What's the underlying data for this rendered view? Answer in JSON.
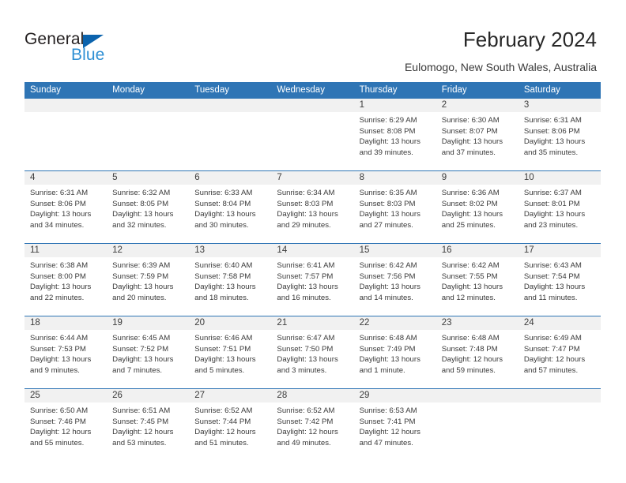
{
  "brand": {
    "name_dark": "General",
    "name_blue": "Blue",
    "colors": {
      "dark": "#231f20",
      "blue": "#2e8fd4",
      "triangle": "#0b63ad"
    }
  },
  "header": {
    "title": "February 2024",
    "subtitle": "Eulomogo, New South Wales, Australia"
  },
  "calendar": {
    "accent_color": "#2f75b5",
    "daynum_band_color": "#f1f1f1",
    "weekday_headers": [
      "Sunday",
      "Monday",
      "Tuesday",
      "Wednesday",
      "Thursday",
      "Friday",
      "Saturday"
    ],
    "labels": {
      "sunrise": "Sunrise:",
      "sunset": "Sunset:",
      "daylight": "Daylight:"
    },
    "weeks": [
      [
        {
          "day": ""
        },
        {
          "day": ""
        },
        {
          "day": ""
        },
        {
          "day": ""
        },
        {
          "day": "1",
          "sunrise": "Sunrise: 6:29 AM",
          "sunset": "Sunset: 8:08 PM",
          "daylight1": "Daylight: 13 hours",
          "daylight2": "and 39 minutes."
        },
        {
          "day": "2",
          "sunrise": "Sunrise: 6:30 AM",
          "sunset": "Sunset: 8:07 PM",
          "daylight1": "Daylight: 13 hours",
          "daylight2": "and 37 minutes."
        },
        {
          "day": "3",
          "sunrise": "Sunrise: 6:31 AM",
          "sunset": "Sunset: 8:06 PM",
          "daylight1": "Daylight: 13 hours",
          "daylight2": "and 35 minutes."
        }
      ],
      [
        {
          "day": "4",
          "sunrise": "Sunrise: 6:31 AM",
          "sunset": "Sunset: 8:06 PM",
          "daylight1": "Daylight: 13 hours",
          "daylight2": "and 34 minutes."
        },
        {
          "day": "5",
          "sunrise": "Sunrise: 6:32 AM",
          "sunset": "Sunset: 8:05 PM",
          "daylight1": "Daylight: 13 hours",
          "daylight2": "and 32 minutes."
        },
        {
          "day": "6",
          "sunrise": "Sunrise: 6:33 AM",
          "sunset": "Sunset: 8:04 PM",
          "daylight1": "Daylight: 13 hours",
          "daylight2": "and 30 minutes."
        },
        {
          "day": "7",
          "sunrise": "Sunrise: 6:34 AM",
          "sunset": "Sunset: 8:03 PM",
          "daylight1": "Daylight: 13 hours",
          "daylight2": "and 29 minutes."
        },
        {
          "day": "8",
          "sunrise": "Sunrise: 6:35 AM",
          "sunset": "Sunset: 8:03 PM",
          "daylight1": "Daylight: 13 hours",
          "daylight2": "and 27 minutes."
        },
        {
          "day": "9",
          "sunrise": "Sunrise: 6:36 AM",
          "sunset": "Sunset: 8:02 PM",
          "daylight1": "Daylight: 13 hours",
          "daylight2": "and 25 minutes."
        },
        {
          "day": "10",
          "sunrise": "Sunrise: 6:37 AM",
          "sunset": "Sunset: 8:01 PM",
          "daylight1": "Daylight: 13 hours",
          "daylight2": "and 23 minutes."
        }
      ],
      [
        {
          "day": "11",
          "sunrise": "Sunrise: 6:38 AM",
          "sunset": "Sunset: 8:00 PM",
          "daylight1": "Daylight: 13 hours",
          "daylight2": "and 22 minutes."
        },
        {
          "day": "12",
          "sunrise": "Sunrise: 6:39 AM",
          "sunset": "Sunset: 7:59 PM",
          "daylight1": "Daylight: 13 hours",
          "daylight2": "and 20 minutes."
        },
        {
          "day": "13",
          "sunrise": "Sunrise: 6:40 AM",
          "sunset": "Sunset: 7:58 PM",
          "daylight1": "Daylight: 13 hours",
          "daylight2": "and 18 minutes."
        },
        {
          "day": "14",
          "sunrise": "Sunrise: 6:41 AM",
          "sunset": "Sunset: 7:57 PM",
          "daylight1": "Daylight: 13 hours",
          "daylight2": "and 16 minutes."
        },
        {
          "day": "15",
          "sunrise": "Sunrise: 6:42 AM",
          "sunset": "Sunset: 7:56 PM",
          "daylight1": "Daylight: 13 hours",
          "daylight2": "and 14 minutes."
        },
        {
          "day": "16",
          "sunrise": "Sunrise: 6:42 AM",
          "sunset": "Sunset: 7:55 PM",
          "daylight1": "Daylight: 13 hours",
          "daylight2": "and 12 minutes."
        },
        {
          "day": "17",
          "sunrise": "Sunrise: 6:43 AM",
          "sunset": "Sunset: 7:54 PM",
          "daylight1": "Daylight: 13 hours",
          "daylight2": "and 11 minutes."
        }
      ],
      [
        {
          "day": "18",
          "sunrise": "Sunrise: 6:44 AM",
          "sunset": "Sunset: 7:53 PM",
          "daylight1": "Daylight: 13 hours",
          "daylight2": "and 9 minutes."
        },
        {
          "day": "19",
          "sunrise": "Sunrise: 6:45 AM",
          "sunset": "Sunset: 7:52 PM",
          "daylight1": "Daylight: 13 hours",
          "daylight2": "and 7 minutes."
        },
        {
          "day": "20",
          "sunrise": "Sunrise: 6:46 AM",
          "sunset": "Sunset: 7:51 PM",
          "daylight1": "Daylight: 13 hours",
          "daylight2": "and 5 minutes."
        },
        {
          "day": "21",
          "sunrise": "Sunrise: 6:47 AM",
          "sunset": "Sunset: 7:50 PM",
          "daylight1": "Daylight: 13 hours",
          "daylight2": "and 3 minutes."
        },
        {
          "day": "22",
          "sunrise": "Sunrise: 6:48 AM",
          "sunset": "Sunset: 7:49 PM",
          "daylight1": "Daylight: 13 hours",
          "daylight2": "and 1 minute."
        },
        {
          "day": "23",
          "sunrise": "Sunrise: 6:48 AM",
          "sunset": "Sunset: 7:48 PM",
          "daylight1": "Daylight: 12 hours",
          "daylight2": "and 59 minutes."
        },
        {
          "day": "24",
          "sunrise": "Sunrise: 6:49 AM",
          "sunset": "Sunset: 7:47 PM",
          "daylight1": "Daylight: 12 hours",
          "daylight2": "and 57 minutes."
        }
      ],
      [
        {
          "day": "25",
          "sunrise": "Sunrise: 6:50 AM",
          "sunset": "Sunset: 7:46 PM",
          "daylight1": "Daylight: 12 hours",
          "daylight2": "and 55 minutes."
        },
        {
          "day": "26",
          "sunrise": "Sunrise: 6:51 AM",
          "sunset": "Sunset: 7:45 PM",
          "daylight1": "Daylight: 12 hours",
          "daylight2": "and 53 minutes."
        },
        {
          "day": "27",
          "sunrise": "Sunrise: 6:52 AM",
          "sunset": "Sunset: 7:44 PM",
          "daylight1": "Daylight: 12 hours",
          "daylight2": "and 51 minutes."
        },
        {
          "day": "28",
          "sunrise": "Sunrise: 6:52 AM",
          "sunset": "Sunset: 7:42 PM",
          "daylight1": "Daylight: 12 hours",
          "daylight2": "and 49 minutes."
        },
        {
          "day": "29",
          "sunrise": "Sunrise: 6:53 AM",
          "sunset": "Sunset: 7:41 PM",
          "daylight1": "Daylight: 12 hours",
          "daylight2": "and 47 minutes."
        },
        {
          "day": ""
        },
        {
          "day": ""
        }
      ]
    ]
  }
}
